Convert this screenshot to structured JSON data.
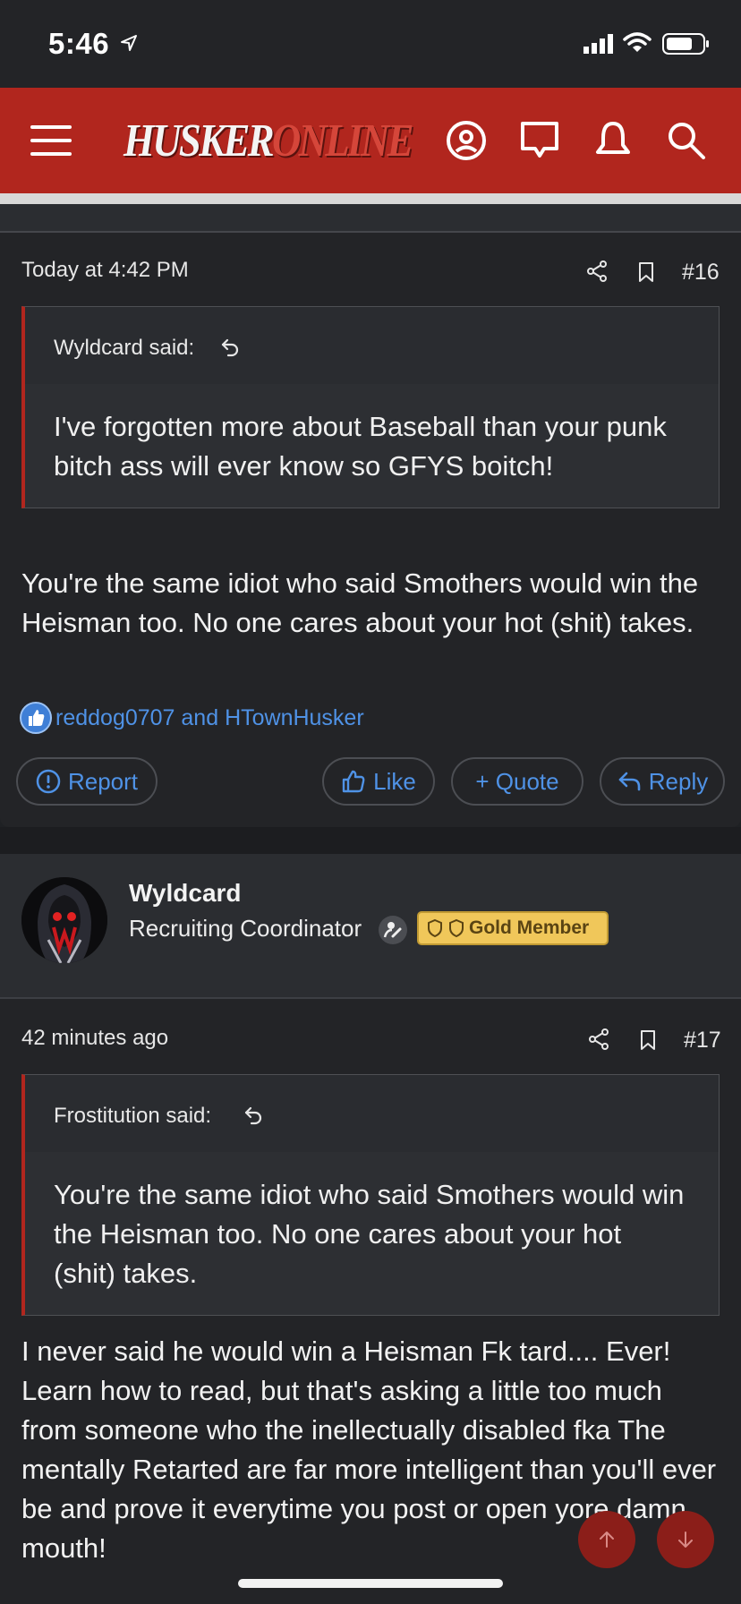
{
  "status": {
    "time": "5:46"
  },
  "header": {
    "logo_part1": "HUSKER",
    "logo_part2": "ONLINE"
  },
  "post16": {
    "date": "Today at 4:42 PM",
    "number": "#16",
    "quote_author": "Wyldcard said:",
    "quote_text": "I've forgotten more about Baseball than your punk bitch ass will ever know so GFYS boitch!",
    "message": "You're the same idiot who said Smothers would win the Heisman too. No one cares about your hot (shit) takes.",
    "reactions": "reddog0707 and HTownHusker",
    "actions": {
      "report": "Report",
      "like": "Like",
      "quote": "+ Quote",
      "reply": "Reply"
    }
  },
  "user": {
    "name": "Wyldcard",
    "title": "Recruiting Coordinator",
    "badge": "Gold Member"
  },
  "post17": {
    "date": "42 minutes ago",
    "number": "#17",
    "quote_author": "Frostitution said:",
    "quote_text": "You're the same idiot who said Smothers would win the Heisman too. No one cares about your hot (shit) takes.",
    "message": "I never said he would win a Heisman Fk tard.... Ever! Learn how to read, but that's asking a little too much from someone who the inellectually disabled fka The mentally Retarted are far more intelligent than you'll ever be and prove it everytime you post or open yore damn mouth!"
  },
  "colors": {
    "brand_red": "#b1261e",
    "link_blue": "#4f92e6",
    "gold": "#f0c75a"
  },
  "icons": [
    "location-arrow-icon",
    "signal-icon",
    "wifi-icon",
    "battery-icon",
    "menu-icon",
    "account-icon",
    "messages-icon",
    "alerts-icon",
    "search-icon",
    "share-icon",
    "bookmark-icon",
    "reply-arrow-icon",
    "like-reaction-icon",
    "report-icon",
    "thumbs-up-icon",
    "reply-icon",
    "staff-icon",
    "shield-icon",
    "scroll-up-icon",
    "scroll-down-icon"
  ]
}
